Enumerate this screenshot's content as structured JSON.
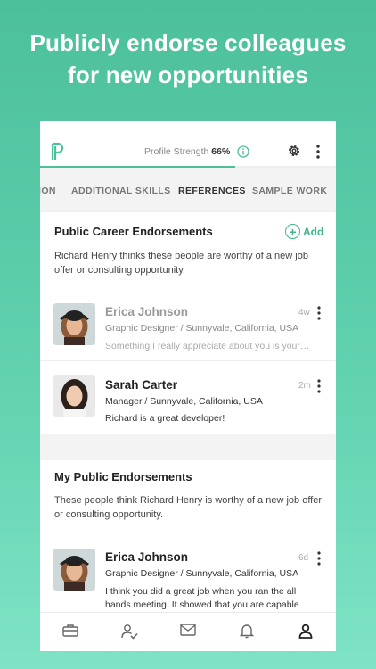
{
  "headline": {
    "line1": "Publicly endorse colleagues",
    "line2": "for new opportunities"
  },
  "topbar": {
    "logo_icon": "p-logo-icon",
    "strength_label": "Profile Strength",
    "strength_value": "66%",
    "strength_fraction": 0.66,
    "info_icon": "info-icon",
    "settings_icon": "gear-icon",
    "more_icon": "more-vertical-icon"
  },
  "tabs": [
    "ION",
    "ADDITIONAL SKILLS",
    "REFERENCES",
    "SAMPLE WORK"
  ],
  "active_tab": "REFERENCES",
  "career": {
    "title": "Public Career Endorsements",
    "add_label": "Add",
    "description": "Richard Henry thinks these people are worthy of a new job offer or consulting opportunity.",
    "items": [
      {
        "name": "Erica Johnson",
        "role": "Graphic Designer / Sunnyvale, California, USA",
        "message": "Something I really appreciate about you is your confidence and",
        "time": "4w"
      },
      {
        "name": "Sarah Carter",
        "role": "Manager / Sunnyvale, California, USA",
        "message": "Richard is a great developer!",
        "time": "2m"
      }
    ]
  },
  "mine": {
    "title": "My Public Endorsements",
    "description": "These people think Richard Henry is worthy of a new job offer or consulting opportunity.",
    "items": [
      {
        "name": "Erica Johnson",
        "role": "Graphic Designer / Sunnyvale, California, USA",
        "message": "I think you did a great job when you ran the all hands meeting. It showed that you are capable",
        "time": "6d"
      }
    ]
  },
  "bottom_nav": [
    "briefcase-icon",
    "user-check-icon",
    "mail-icon",
    "bell-icon",
    "profile-icon"
  ],
  "colors": {
    "accent": "#4cbf9b",
    "background_top": "#4cbf9b",
    "background_bottom": "#7fe3c5"
  }
}
